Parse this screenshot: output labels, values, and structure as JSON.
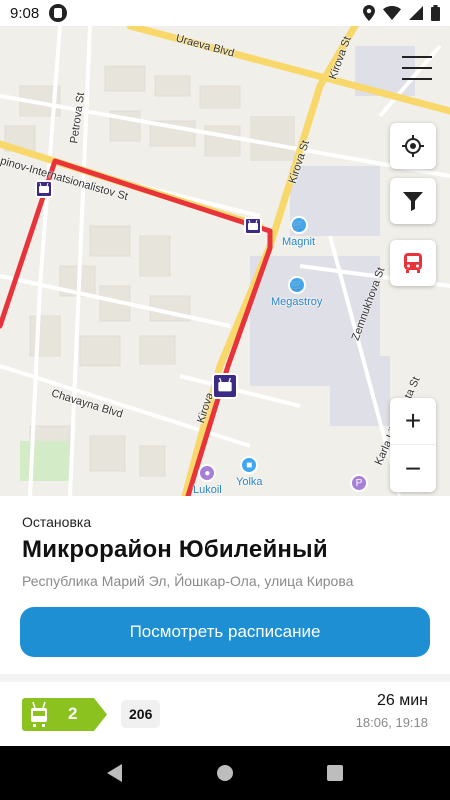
{
  "status_bar": {
    "time": "9:08"
  },
  "map": {
    "streets": {
      "uraeva": "Uraeva Blvd",
      "kirova_top": "Kirova St",
      "petrova": "Petrova St",
      "internatsionalistov": "pinov-Internatsionalistov St",
      "kirova_mid": "Kirova St",
      "chavayna": "Chavayna Blvd",
      "kirova_low": "Kirova",
      "zemnukhova": "Zemnukhova St",
      "karla": "Karla Libknekhta St"
    },
    "pois": {
      "magnit": "Magnit",
      "megastroy": "Megastroy",
      "yolka": "Yolka",
      "lukoil": "Lukoil"
    },
    "route_color": "#e8333a"
  },
  "stop": {
    "kind": "Остановка",
    "name": "Микрорайон Юбилейный",
    "address": "Республика Марий Эл, Йошкар-Ола, улица Кирова",
    "schedule_button": "Посмотреть расписание"
  },
  "routes": [
    {
      "number": "2",
      "plate": "206",
      "eta": "26 мин",
      "times": "18:06, 19:18",
      "badge_color": "#8bc220"
    }
  ],
  "colors": {
    "accent": "#1f8fd4",
    "stop_marker": "#3b2a86"
  }
}
